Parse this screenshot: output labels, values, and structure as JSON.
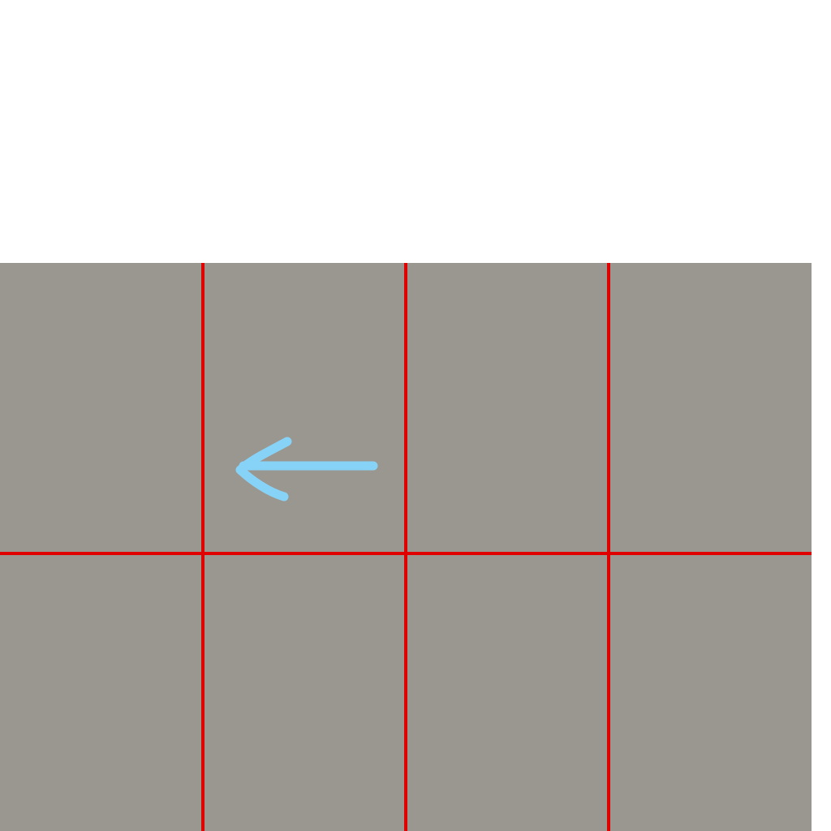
{
  "colors": {
    "background": "#ffffff",
    "tile": "#9a9790",
    "grid_line": "#e00000",
    "arrow": "#87d3f8"
  },
  "grid": {
    "columns": 4,
    "rows": 2
  },
  "arrow": {
    "icon": "arrow-left-icon",
    "direction": "left"
  }
}
